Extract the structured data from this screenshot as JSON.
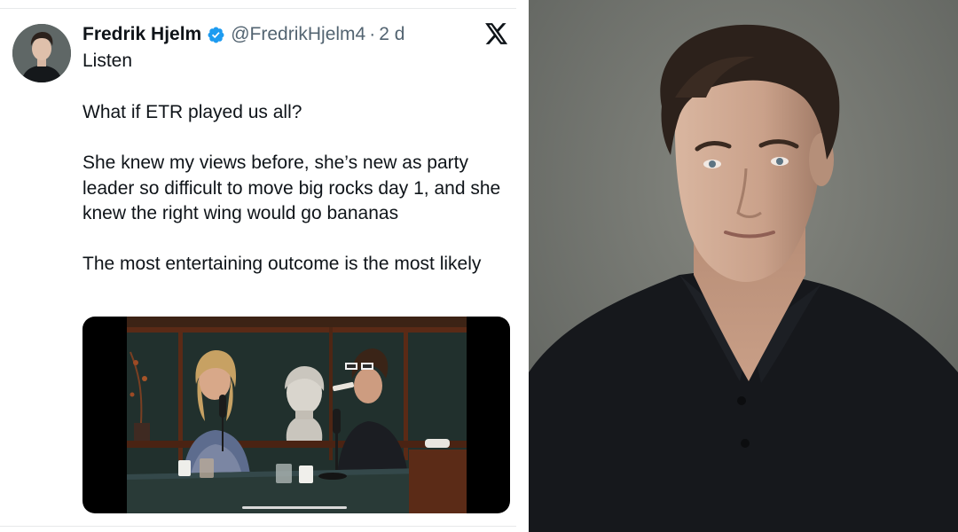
{
  "tweet": {
    "author": {
      "display_name": "Fredrik Hjelm",
      "handle": "@FredrikHjelm4",
      "verified": true
    },
    "separator": "·",
    "timestamp": "2 d",
    "listen_label": "Listen",
    "body": [
      "What if ETR played us all?",
      "She knew my views before, she’s new as party leader so difficult to move big rocks day 1, and she knew the right wing would go bananas",
      "The most entertaining outcome is the most likely"
    ],
    "icons": {
      "verified": "verified-badge-icon",
      "platform": "x-logo-icon"
    },
    "colors": {
      "verified_blue": "#1d9bf0",
      "text_primary": "#0f1419",
      "text_secondary": "#536471"
    }
  }
}
